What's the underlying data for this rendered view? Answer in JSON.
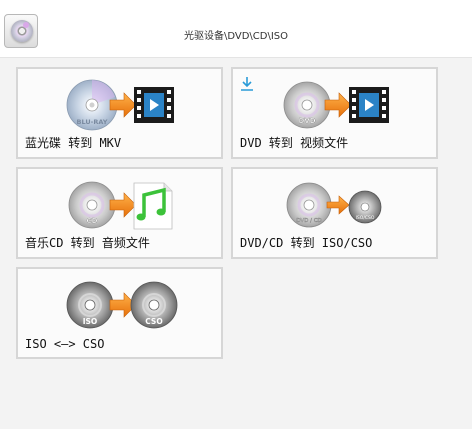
{
  "window": {
    "title": "光驱设备\\DVD\\CD\\ISO",
    "app_icon": "optical-disc-icon"
  },
  "cards": [
    {
      "label": "蓝光碟 转到 MKV",
      "source_disc_text": "BLU-RAY",
      "target": "film-strip-icon",
      "download_badge": false
    },
    {
      "label": "DVD 转到 视频文件",
      "source_disc_text": "DVD",
      "target": "film-strip-icon",
      "download_badge": true
    },
    {
      "label": "音乐CD 转到 音频文件",
      "source_disc_text": "CD",
      "target": "music-file-icon",
      "download_badge": false
    },
    {
      "label": "DVD/CD 转到 ISO/CSO",
      "source_disc_text": "DVD / CD",
      "target_disc_text": "ISO/CSO",
      "download_badge": false
    },
    {
      "label": "ISO <—> CSO",
      "source_disc_text": "ISO",
      "target_disc_text": "CSO",
      "download_badge": false
    }
  ],
  "colors": {
    "accent_blue": "#2a9bd8",
    "arrow_orange": "#f08a1c",
    "music_green": "#3cc23a",
    "card_border": "#d6d6d6"
  }
}
